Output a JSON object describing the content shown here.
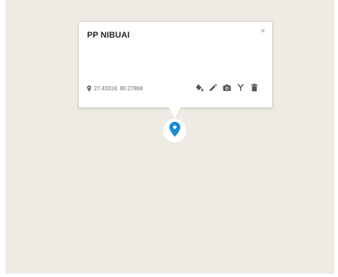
{
  "popup": {
    "title": "PP NIBUAI",
    "close_label": "×",
    "coordinates": "27.43318, 80.27868",
    "tools": [
      {
        "name": "paint-bucket-icon"
      },
      {
        "name": "pencil-icon"
      },
      {
        "name": "camera-icon"
      },
      {
        "name": "fork-icon"
      },
      {
        "name": "trash-icon"
      }
    ]
  },
  "marker": {
    "icon": "map-pin-icon",
    "color": "#1a8ad4"
  },
  "colors": {
    "map_background": "#eeebe4",
    "icon": "#555555",
    "accent": "#1a8ad4"
  }
}
